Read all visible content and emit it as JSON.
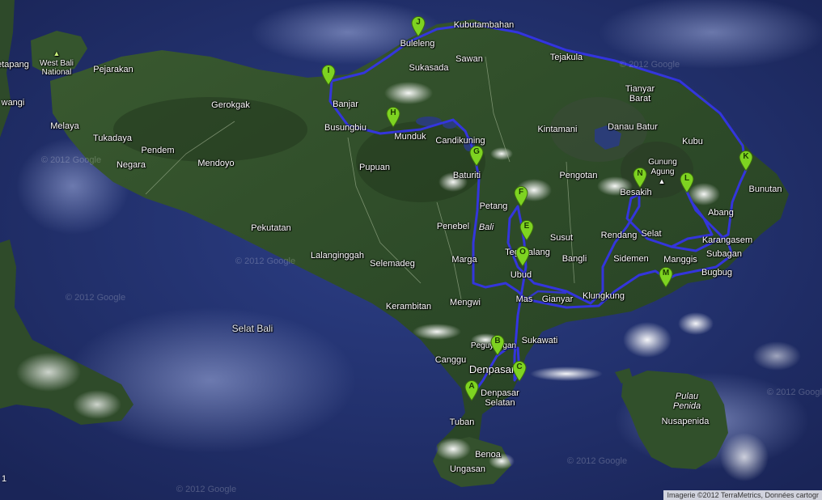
{
  "map": {
    "attribution": "Imagerie ©2012 TerraMetrics, Données cartogr",
    "watermark": "© 2012 Google",
    "scale_mark": "1",
    "colors": {
      "route": "#3535e6",
      "marker": "#7ed321",
      "sea": "#24367a",
      "land": "#2e4a2a"
    }
  },
  "markers": [
    {
      "label": "A"
    },
    {
      "label": "B"
    },
    {
      "label": "C"
    },
    {
      "label": "E"
    },
    {
      "label": "F"
    },
    {
      "label": "G"
    },
    {
      "label": "H"
    },
    {
      "label": "I"
    },
    {
      "label": "J"
    },
    {
      "label": "K"
    },
    {
      "label": "L"
    },
    {
      "label": "M"
    },
    {
      "label": "N"
    },
    {
      "label": "O"
    }
  ],
  "places": {
    "west_bali_national": "West Bali National",
    "pejarakan": "Pejarakan",
    "etapang": "etapang",
    "wangi": "wangi",
    "gerokgak": "Gerokgak",
    "melaya": "Melaya",
    "tukadaya": "Tukadaya",
    "pendem": "Pendem",
    "negara": "Negara",
    "mendoyo": "Mendoyo",
    "pekutatan": "Pekutatan",
    "lalanginggah": "Lalanginggah",
    "selemadeg": "Selemadeg",
    "banjar": "Banjar",
    "busungbiu": "Busungbiu",
    "munduk": "Munduk",
    "pupuan": "Pupuan",
    "buleleng": "Buleleng",
    "sukasada": "Sukasada",
    "sawan": "Sawan",
    "kubutambahan": "Kubutambahan",
    "tejakula": "Tejakula",
    "tianyar_barat": "Tianyar Barat",
    "kintamani": "Kintamani",
    "danau_batur": "Danau Batur",
    "candikuning": "Candikuning",
    "baturiti": "Baturiti",
    "pengotan": "Pengotan",
    "gunung_agung": "Gunung Agung",
    "kubu": "Kubu",
    "bunutan": "Bunutan",
    "besakih": "Besakih",
    "abang": "Abang",
    "karangasem": "Karangasem",
    "selat": "Selat",
    "rendang": "Rendang",
    "petang": "Petang",
    "penebel": "Penebel",
    "bali": "Bali",
    "tegallalang": "Tegallalang",
    "susut": "Susut",
    "bangli": "Bangli",
    "sidemen": "Sidemen",
    "manggis": "Manggis",
    "subagan": "Subagan",
    "bugbug": "Bugbug",
    "marga": "Marga",
    "ubud": "Ubud",
    "mas": "Mas",
    "gianyar": "Gianyar",
    "klungkung": "Klungkung",
    "kerambitan": "Kerambitan",
    "mengwi": "Mengwi",
    "sukawati": "Sukawati",
    "selat_bali": "Selat Bali",
    "canggu": "Canggu",
    "peguyangan": "Peguyangan",
    "denpasar": "Denpasar",
    "denpasar_selatan": "Denpasar Selatan",
    "tuban": "Tuban",
    "benoa": "Benoa",
    "ungasan": "Ungasan",
    "pulau_penida": "Pulau Penida",
    "nusapenida": "Nusapenida"
  }
}
